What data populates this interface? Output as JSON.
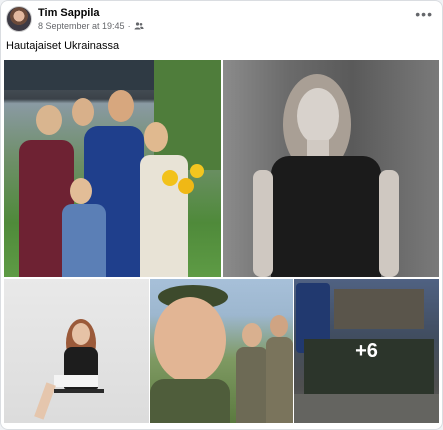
{
  "post": {
    "author": "Tim Sappila",
    "timestamp": "8 September at 19:45",
    "audience_icon": "friends-icon",
    "caption": "Hautajaiset Ukrainassa",
    "more_options_icon": "more-options-icon",
    "more_options_glyph": "•••"
  },
  "gallery": {
    "photo_count_shown": 5,
    "extra_count_label": "+6"
  },
  "colors": {
    "background": "#ffffff",
    "secondary_text": "#65676b",
    "border": "#dadde1"
  }
}
